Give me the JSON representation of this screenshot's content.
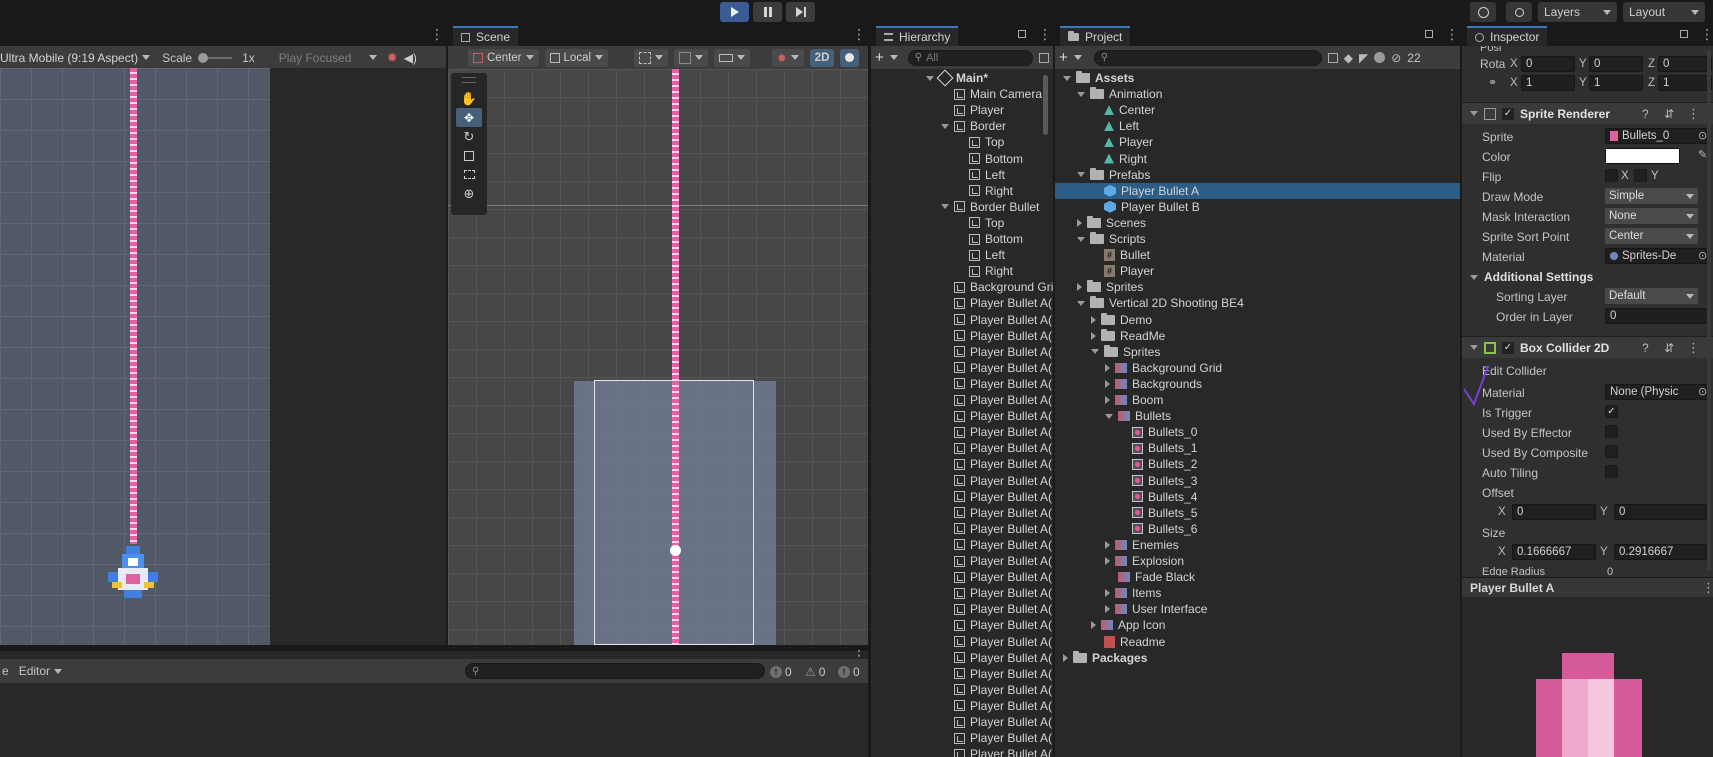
{
  "toolbar": {
    "layers_label": "Layers",
    "layout_label": "Layout"
  },
  "game": {
    "aspect": "Ultra Mobile (9:19 Aspect)",
    "scale_label": "Scale",
    "scale_value": "1x",
    "play_mode": "Play Focused"
  },
  "scene": {
    "tab_label": "Scene",
    "pivot": "Center",
    "space": "Local",
    "mode_2d": "2D"
  },
  "console": {
    "editor_label": "Editor",
    "clear_label": "e",
    "log_count": "0",
    "warn_count": "0",
    "error_count": "0"
  },
  "hierarchy": {
    "tab_label": "Hierarchy",
    "search_placeholder": "All",
    "items": [
      {
        "label": "Main*",
        "depth": 0,
        "arrow": "down",
        "icon": "unity-scene-icon",
        "bold": true
      },
      {
        "label": "Main Camera",
        "depth": 1,
        "arrow": "none",
        "icon": "gameobject-icon"
      },
      {
        "label": "Player",
        "depth": 1,
        "arrow": "none",
        "icon": "gameobject-icon"
      },
      {
        "label": "Border",
        "depth": 1,
        "arrow": "down",
        "icon": "gameobject-icon"
      },
      {
        "label": "Top",
        "depth": 2,
        "arrow": "none",
        "icon": "gameobject-icon"
      },
      {
        "label": "Bottom",
        "depth": 2,
        "arrow": "none",
        "icon": "gameobject-icon"
      },
      {
        "label": "Left",
        "depth": 2,
        "arrow": "none",
        "icon": "gameobject-icon"
      },
      {
        "label": "Right",
        "depth": 2,
        "arrow": "none",
        "icon": "gameobject-icon"
      },
      {
        "label": "Border Bullet",
        "depth": 1,
        "arrow": "down",
        "icon": "gameobject-icon"
      },
      {
        "label": "Top",
        "depth": 2,
        "arrow": "none",
        "icon": "gameobject-icon"
      },
      {
        "label": "Bottom",
        "depth": 2,
        "arrow": "none",
        "icon": "gameobject-icon"
      },
      {
        "label": "Left",
        "depth": 2,
        "arrow": "none",
        "icon": "gameobject-icon"
      },
      {
        "label": "Right",
        "depth": 2,
        "arrow": "none",
        "icon": "gameobject-icon"
      },
      {
        "label": "Background Gri",
        "depth": 1,
        "arrow": "none",
        "icon": "gameobject-icon"
      },
      {
        "label": "Player Bullet A(",
        "depth": 1,
        "arrow": "none",
        "icon": "gameobject-icon"
      },
      {
        "label": "Player Bullet A(",
        "depth": 1,
        "arrow": "none",
        "icon": "gameobject-icon"
      },
      {
        "label": "Player Bullet A(",
        "depth": 1,
        "arrow": "none",
        "icon": "gameobject-icon"
      },
      {
        "label": "Player Bullet A(",
        "depth": 1,
        "arrow": "none",
        "icon": "gameobject-icon"
      },
      {
        "label": "Player Bullet A(",
        "depth": 1,
        "arrow": "none",
        "icon": "gameobject-icon"
      },
      {
        "label": "Player Bullet A(",
        "depth": 1,
        "arrow": "none",
        "icon": "gameobject-icon"
      },
      {
        "label": "Player Bullet A(",
        "depth": 1,
        "arrow": "none",
        "icon": "gameobject-icon"
      },
      {
        "label": "Player Bullet A(",
        "depth": 1,
        "arrow": "none",
        "icon": "gameobject-icon"
      },
      {
        "label": "Player Bullet A(",
        "depth": 1,
        "arrow": "none",
        "icon": "gameobject-icon"
      },
      {
        "label": "Player Bullet A(",
        "depth": 1,
        "arrow": "none",
        "icon": "gameobject-icon"
      },
      {
        "label": "Player Bullet A(",
        "depth": 1,
        "arrow": "none",
        "icon": "gameobject-icon"
      },
      {
        "label": "Player Bullet A(",
        "depth": 1,
        "arrow": "none",
        "icon": "gameobject-icon"
      },
      {
        "label": "Player Bullet A(",
        "depth": 1,
        "arrow": "none",
        "icon": "gameobject-icon"
      },
      {
        "label": "Player Bullet A(",
        "depth": 1,
        "arrow": "none",
        "icon": "gameobject-icon"
      },
      {
        "label": "Player Bullet A(",
        "depth": 1,
        "arrow": "none",
        "icon": "gameobject-icon"
      },
      {
        "label": "Player Bullet A(",
        "depth": 1,
        "arrow": "none",
        "icon": "gameobject-icon"
      },
      {
        "label": "Player Bullet A(",
        "depth": 1,
        "arrow": "none",
        "icon": "gameobject-icon"
      },
      {
        "label": "Player Bullet A(",
        "depth": 1,
        "arrow": "none",
        "icon": "gameobject-icon"
      },
      {
        "label": "Player Bullet A(",
        "depth": 1,
        "arrow": "none",
        "icon": "gameobject-icon"
      },
      {
        "label": "Player Bullet A(",
        "depth": 1,
        "arrow": "none",
        "icon": "gameobject-icon"
      },
      {
        "label": "Player Bullet A(",
        "depth": 1,
        "arrow": "none",
        "icon": "gameobject-icon"
      },
      {
        "label": "Player Bullet A(",
        "depth": 1,
        "arrow": "none",
        "icon": "gameobject-icon"
      },
      {
        "label": "Player Bullet A(",
        "depth": 1,
        "arrow": "none",
        "icon": "gameobject-icon"
      },
      {
        "label": "Player Bullet A(",
        "depth": 1,
        "arrow": "none",
        "icon": "gameobject-icon"
      },
      {
        "label": "Player Bullet A(",
        "depth": 1,
        "arrow": "none",
        "icon": "gameobject-icon"
      },
      {
        "label": "Player Bullet A(",
        "depth": 1,
        "arrow": "none",
        "icon": "gameobject-icon"
      },
      {
        "label": "Player Bullet A(",
        "depth": 1,
        "arrow": "none",
        "icon": "gameobject-icon"
      },
      {
        "label": "Player Bullet A(",
        "depth": 1,
        "arrow": "none",
        "icon": "gameobject-icon"
      },
      {
        "label": "Player Bullet A(",
        "depth": 1,
        "arrow": "none",
        "icon": "gameobject-icon"
      },
      {
        "label": "Player Bullet A(",
        "depth": 1,
        "arrow": "none",
        "icon": "gameobject-icon"
      }
    ]
  },
  "project": {
    "tab_label": "Project",
    "hidden_count": "22",
    "items": [
      {
        "label": "Assets",
        "depth": 0,
        "arrow": "down",
        "icon": "folder-icon",
        "bold": true
      },
      {
        "label": "Animation",
        "depth": 1,
        "arrow": "down",
        "icon": "folder-icon"
      },
      {
        "label": "Center",
        "depth": 2,
        "arrow": "none",
        "icon": "animation-icon"
      },
      {
        "label": "Left",
        "depth": 2,
        "arrow": "none",
        "icon": "animation-icon"
      },
      {
        "label": "Player",
        "depth": 2,
        "arrow": "none",
        "icon": "animation-icon"
      },
      {
        "label": "Right",
        "depth": 2,
        "arrow": "none",
        "icon": "animation-icon"
      },
      {
        "label": "Prefabs",
        "depth": 1,
        "arrow": "down",
        "icon": "folder-icon"
      },
      {
        "label": "Player Bullet A",
        "depth": 2,
        "arrow": "none",
        "icon": "prefab-icon",
        "selected": true
      },
      {
        "label": "Player Bullet B",
        "depth": 2,
        "arrow": "none",
        "icon": "prefab-icon"
      },
      {
        "label": "Scenes",
        "depth": 1,
        "arrow": "right",
        "icon": "folder-icon"
      },
      {
        "label": "Scripts",
        "depth": 1,
        "arrow": "down",
        "icon": "folder-icon"
      },
      {
        "label": "Bullet",
        "depth": 2,
        "arrow": "none",
        "icon": "script-icon"
      },
      {
        "label": "Player",
        "depth": 2,
        "arrow": "none",
        "icon": "script-icon"
      },
      {
        "label": "Sprites",
        "depth": 1,
        "arrow": "right",
        "icon": "folder-icon"
      },
      {
        "label": "Vertical 2D Shooting BE4",
        "depth": 1,
        "arrow": "down",
        "icon": "folder-icon"
      },
      {
        "label": "Demo",
        "depth": 2,
        "arrow": "right",
        "icon": "folder-icon"
      },
      {
        "label": "ReadMe",
        "depth": 2,
        "arrow": "right",
        "icon": "folder-icon"
      },
      {
        "label": "Sprites",
        "depth": 2,
        "arrow": "down",
        "icon": "folder-icon"
      },
      {
        "label": "Background Grid",
        "depth": 3,
        "arrow": "right",
        "icon": "sprite-sheet-icon"
      },
      {
        "label": "Backgrounds",
        "depth": 3,
        "arrow": "right",
        "icon": "sprite-sheet-icon"
      },
      {
        "label": "Boom",
        "depth": 3,
        "arrow": "right",
        "icon": "sprite-sheet-icon"
      },
      {
        "label": "Bullets",
        "depth": 3,
        "arrow": "down",
        "icon": "sprite-sheet-icon"
      },
      {
        "label": "Bullets_0",
        "depth": 4,
        "arrow": "none",
        "icon": "sprite-icon"
      },
      {
        "label": "Bullets_1",
        "depth": 4,
        "arrow": "none",
        "icon": "sprite-icon"
      },
      {
        "label": "Bullets_2",
        "depth": 4,
        "arrow": "none",
        "icon": "sprite-icon"
      },
      {
        "label": "Bullets_3",
        "depth": 4,
        "arrow": "none",
        "icon": "sprite-icon"
      },
      {
        "label": "Bullets_4",
        "depth": 4,
        "arrow": "none",
        "icon": "sprite-icon"
      },
      {
        "label": "Bullets_5",
        "depth": 4,
        "arrow": "none",
        "icon": "sprite-icon"
      },
      {
        "label": "Bullets_6",
        "depth": 4,
        "arrow": "none",
        "icon": "sprite-icon"
      },
      {
        "label": "Enemies",
        "depth": 3,
        "arrow": "right",
        "icon": "sprite-sheet-icon"
      },
      {
        "label": "Explosion",
        "depth": 3,
        "arrow": "right",
        "icon": "sprite-sheet-icon"
      },
      {
        "label": "Fade Black",
        "depth": 3,
        "arrow": "none",
        "icon": "sprite-sheet-icon"
      },
      {
        "label": "Items",
        "depth": 3,
        "arrow": "right",
        "icon": "sprite-sheet-icon"
      },
      {
        "label": "User Interface",
        "depth": 3,
        "arrow": "right",
        "icon": "sprite-sheet-icon"
      },
      {
        "label": "App Icon",
        "depth": 2,
        "arrow": "right",
        "icon": "sprite-sheet-icon"
      },
      {
        "label": "Readme",
        "depth": 2,
        "arrow": "none",
        "icon": "readme-icon"
      },
      {
        "label": "Packages",
        "depth": 0,
        "arrow": "right",
        "icon": "folder-icon",
        "bold": true
      }
    ]
  },
  "inspector": {
    "tab_label": "Inspector",
    "transform": {
      "rotation_label": "Rota",
      "rot_x": "0",
      "rot_y": "0",
      "rot_z": "0",
      "scale_x": "1",
      "scale_y": "1",
      "scale_z": "1",
      "x_label": "X",
      "y_label": "Y",
      "z_label": "Z"
    },
    "sprite_renderer": {
      "title": "Sprite Renderer",
      "sprite_label": "Sprite",
      "sprite_value": "Bullets_0",
      "color_label": "Color",
      "color_value": "#ffffff",
      "flip_label": "Flip",
      "flip_x": "X",
      "flip_y": "Y",
      "draw_mode_label": "Draw Mode",
      "draw_mode_value": "Simple",
      "mask_label": "Mask Interaction",
      "mask_value": "None",
      "sort_point_label": "Sprite Sort Point",
      "sort_point_value": "Center",
      "material_label": "Material",
      "material_value": "Sprites-De",
      "additional_label": "Additional Settings",
      "sorting_layer_label": "Sorting Layer",
      "sorting_layer_value": "Default",
      "order_label": "Order in Layer",
      "order_value": "0"
    },
    "box_collider": {
      "title": "Box Collider 2D",
      "edit_label": "Edit Collider",
      "material_label": "Material",
      "material_value": "None (Physic",
      "trigger_label": "Is Trigger",
      "trigger_checked": true,
      "effector_label": "Used By Effector",
      "composite_label": "Used By Composite",
      "tiling_label": "Auto Tiling",
      "offset_label": "Offset",
      "offset_x": "0",
      "offset_y": "0",
      "size_label": "Size",
      "size_x": "0.1666667",
      "size_y": "0.2916667",
      "edge_label": "Edge Radius",
      "edge_value": "0"
    },
    "preview_title": "Player Bullet A"
  },
  "colors": {
    "accent": "#3a79bb",
    "laser": "#e75ea7",
    "selection": "#2c5d87",
    "play_active": "#3a5b94"
  }
}
